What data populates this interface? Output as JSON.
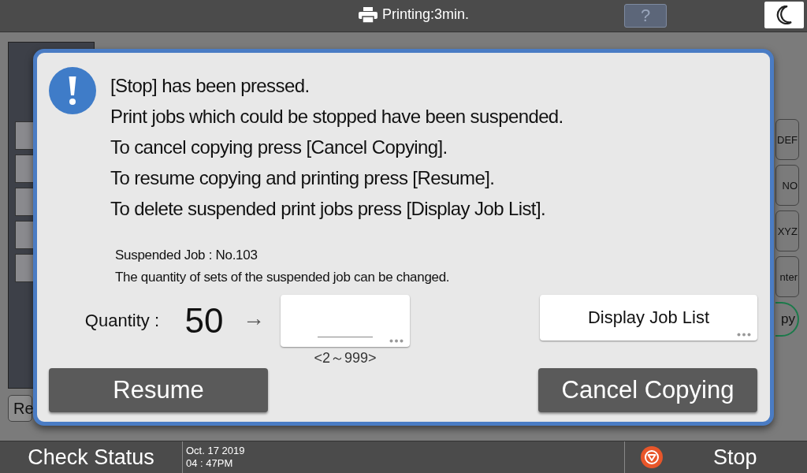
{
  "top_bar": {
    "status": "Printing:3min.",
    "help": "?"
  },
  "background": {
    "left_button": "Re",
    "side_keys": [
      "DEF",
      "NO",
      "XYZ",
      "nter"
    ],
    "round_key": "py"
  },
  "dialog": {
    "message_lines": [
      "[Stop] has been pressed.",
      "Print jobs which could be stopped have been suspended.",
      "To cancel copying press [Cancel Copying].",
      "To resume copying and printing press [Resume].",
      "To delete suspended print jobs press [Display Job List]."
    ],
    "job": "Suspended Job : No.103",
    "note": "The quantity of sets of the suspended job can be changed.",
    "quantity_label": "Quantity :",
    "quantity_value": "50",
    "arrow": "→",
    "range": "<2～999>",
    "display_job_list": "Display Job List",
    "resume": "Resume",
    "cancel": "Cancel Copying"
  },
  "bottom_bar": {
    "check_status": "Check Status",
    "date": "Oct. 17 2019",
    "time": "04 : 47PM",
    "stop": "Stop"
  }
}
